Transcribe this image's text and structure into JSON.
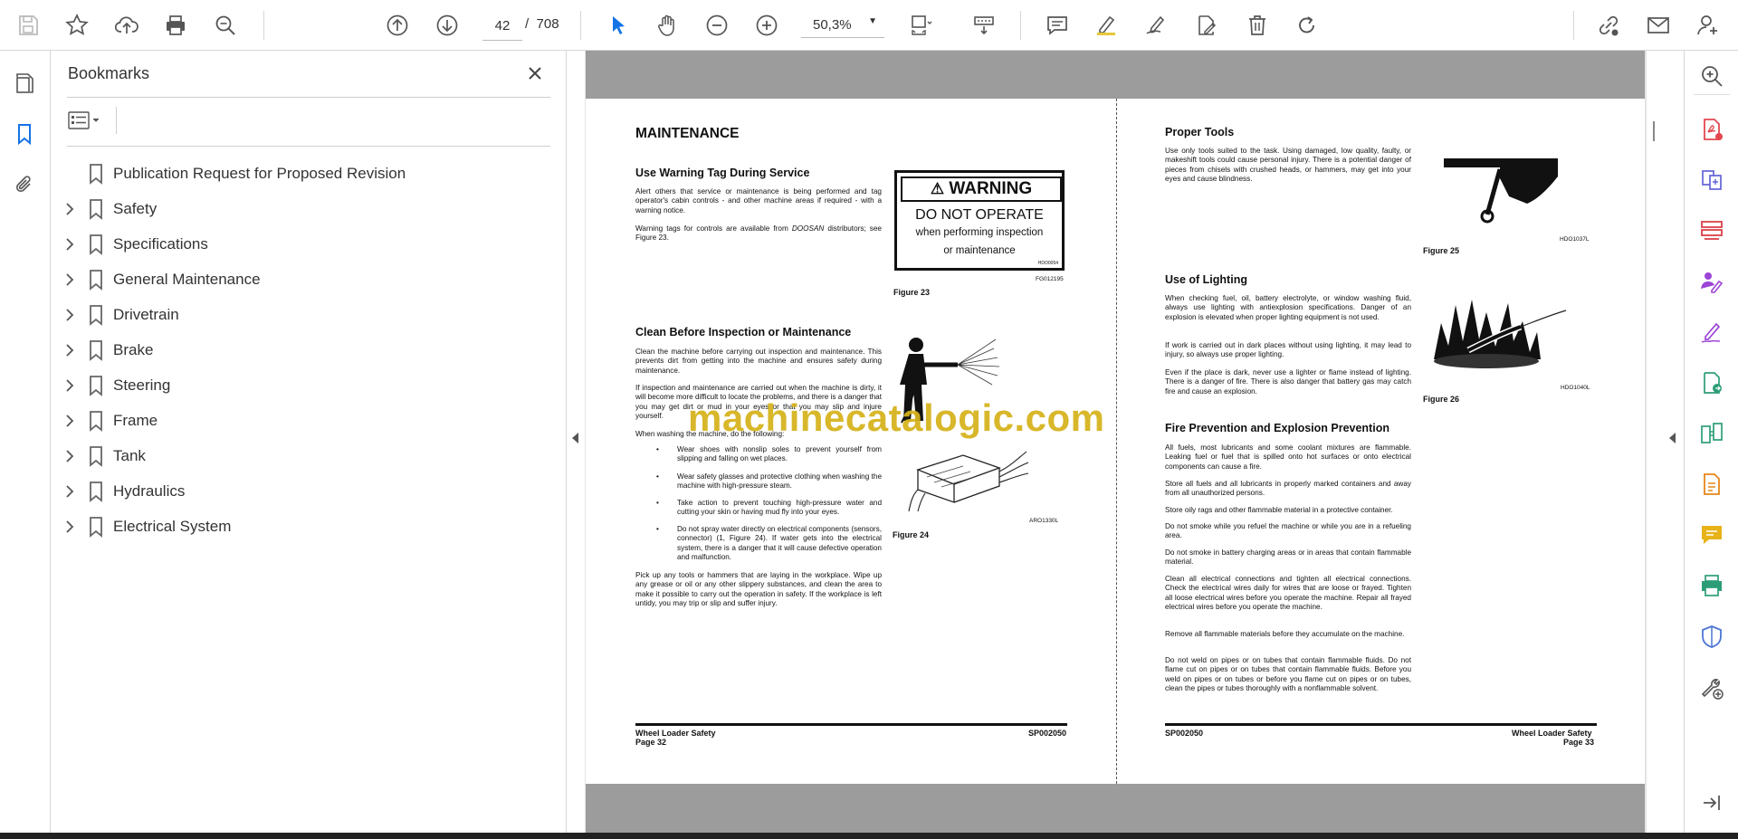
{
  "toolbar": {
    "page_current": "42",
    "page_separator": "/",
    "page_total": "708",
    "zoom": "50,3%",
    "accent_color": "#1473e6",
    "icons": [
      "save-icon",
      "star-icon",
      "upload-icon",
      "print-icon",
      "search-zoom-icon",
      "page-up-icon",
      "page-down-icon",
      "select-cursor-icon",
      "hand-tool-icon",
      "zoom-out-icon",
      "zoom-in-icon",
      "fit-page-icon",
      "scroll-mode-icon",
      "comment-icon",
      "highlight-icon",
      "sign-icon",
      "edit-pdf-icon",
      "delete-icon",
      "rotate-icon",
      "share-link-icon",
      "email-icon",
      "account-icon"
    ]
  },
  "bookmarks": {
    "title": "Bookmarks",
    "items": [
      {
        "label": "Publication Request for Proposed Revision",
        "expandable": false
      },
      {
        "label": "Safety",
        "expandable": true
      },
      {
        "label": "Specifications",
        "expandable": true
      },
      {
        "label": "General Maintenance",
        "expandable": true
      },
      {
        "label": "Drivetrain",
        "expandable": true
      },
      {
        "label": "Brake",
        "expandable": true
      },
      {
        "label": "Steering",
        "expandable": true
      },
      {
        "label": "Frame",
        "expandable": true
      },
      {
        "label": "Tank",
        "expandable": true
      },
      {
        "label": "Hydraulics",
        "expandable": true
      },
      {
        "label": "Electrical System",
        "expandable": true
      }
    ]
  },
  "document": {
    "left": {
      "heading": "MAINTENANCE",
      "s1_title": "Use Warning Tag During Service",
      "s1_p1": "Alert others that service or maintenance is being performed and tag operator's cabin controls - and other machine areas if required - with a warning notice.",
      "s1_p2_a": "Warning tags for controls are available from ",
      "s1_p2_em": "DOOSAN",
      "s1_p2_b": " distributors; see Figure 23.",
      "warning_title": "WARNING",
      "warning_line1": "DO NOT OPERATE",
      "warning_line2": "when performing inspection",
      "warning_line3": "or maintenance",
      "warning_code": "HDO0054",
      "fig23_code": "FG012195",
      "fig23": "Figure 23",
      "s2_title": "Clean Before Inspection or Maintenance",
      "s2_p1": "Clean the machine before carrying out inspection and maintenance. This prevents dirt from getting into the machine and ensures safety during maintenance.",
      "s2_p2": "If inspection and maintenance are carried out when the machine is dirty, it will become more difficult to locate the problems, and there is a danger that you may get dirt or mud in your eyes or that you may slip and injure yourself.",
      "s2_p3": "When washing the machine, do the following:",
      "bullets": [
        "Wear shoes with nonslip soles to prevent yourself from slipping and falling on wet places.",
        "Wear safety glasses and protective clothing when washing the machine with high-pressure steam.",
        "Take action to prevent touching high-pressure water and cutting your skin or having mud fly into your eyes.",
        "Do not spray water directly on electrical components (sensors, connector) (1, Figure 24). If water gets into the electrical system, there is a danger that it will cause defective operation and malfunction."
      ],
      "s2_p4": "Pick up any tools or hammers that are laying in the workplace. Wipe up any grease or oil or any other slippery substances, and clean the area to make it possible to carry out the operation in safety. If the workplace is left untidy, you may trip or slip and suffer injury.",
      "fig24_code": "ARO1330L",
      "fig24": "Figure 24",
      "footer_title": "Wheel Loader Safety",
      "footer_page": "Page 32",
      "footer_code": "SP002050"
    },
    "right": {
      "s1_title": "Proper Tools",
      "s1_p1": "Use only tools suited to the task. Using damaged, low quality, faulty, or makeshift tools could cause personal injury. There is a potential danger of pieces from chisels with crushed heads, or hammers, may get into your eyes and cause blindness.",
      "fig25_code": "HDO1037L",
      "fig25": "Figure 25",
      "s2_title": "Use of Lighting",
      "s2_p1": "When checking fuel, oil, battery electrolyte, or window washing fluid, always use lighting with antiexplosion specifications. Danger of an explosion is elevated when proper lighting equipment is not used.",
      "s2_p2": "If work is carried out in dark places without using lighting, it may lead to injury, so always use proper lighting.",
      "s2_p3": "Even if the place is dark, never use a lighter or flame instead of lighting. There is a danger of fire. There is also danger that battery gas may catch fire and cause an explosion.",
      "fig26_code": "HDO1040L",
      "fig26": "Figure 26",
      "s3_title": "Fire Prevention and Explosion Prevention",
      "s3_p1": "All fuels, most lubricants and some coolant mixtures are flammable. Leaking fuel or fuel that is spilled onto hot surfaces or onto electrical components can cause a fire.",
      "s3_p2": "Store all fuels and all lubricants in properly marked containers and away from all unauthorized persons.",
      "s3_p3": "Store oily rags and other flammable material in a protective container.",
      "s3_p4": "Do not smoke while you refuel the machine or while you are in a refueling area.",
      "s3_p5": "Do not smoke in battery charging areas or in areas that contain flammable material.",
      "s3_p6": "Clean all electrical connections and tighten all electrical connections. Check the electrical wires daily for wires that are loose or frayed. Tighten all loose electrical wires before you operate the machine. Repair all frayed electrical wires before you operate the machine.",
      "s3_p7": "Remove all flammable materials before they accumulate on the machine.",
      "s3_p8": "Do not weld on pipes or on tubes that contain flammable fluids. Do not flame cut on pipes or on tubes that contain flammable fluids. Before you weld on pipes or on tubes or before you flame cut on pipes or on tubes, clean the pipes or tubes thoroughly with a nonflammable solvent.",
      "footer_code": "SP002050",
      "footer_title": "Wheel Loader Safety",
      "footer_page": "Page 33"
    },
    "watermark": "machinecatalogic.com",
    "watermark_color": "#d6b21a"
  }
}
